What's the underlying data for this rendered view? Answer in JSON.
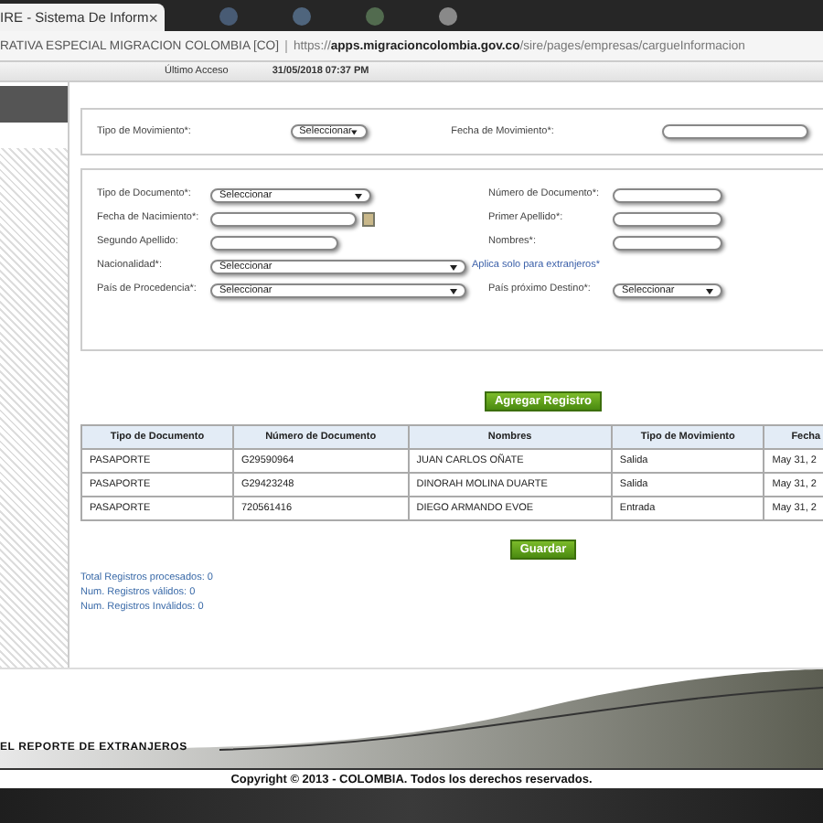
{
  "browser": {
    "tab_title": "IRE - Sistema De Inform",
    "tab_close": "×",
    "site_name": "RATIVA ESPECIAL MIGRACION COLOMBIA [CO]",
    "url_prefix": "https://",
    "url_host": "apps.migracioncolombia.gov.co",
    "url_path": "/sire/pages/empresas/cargueInformacion"
  },
  "header": {
    "last_access_label": "Último Acceso",
    "last_access_value": "31/05/2018 07:37 PM"
  },
  "movement_panel": {
    "fields": [
      {
        "label": "Tipo de Movimiento*:",
        "kind": "select",
        "value": "Seleccionar"
      },
      {
        "label": "Fecha de Movimiento*:",
        "kind": "input"
      }
    ]
  },
  "document_form": {
    "fields": [
      {
        "label": "Tipo de Documento*:",
        "kind": "select",
        "value": "Seleccionar"
      },
      {
        "label": "Número de Documento*:",
        "kind": "input"
      },
      {
        "label": "Fecha de Nacimiento*:",
        "kind": "date"
      },
      {
        "label": "Primer Apellido*:",
        "kind": "input"
      },
      {
        "label": "Segundo Apellido:",
        "kind": "input"
      },
      {
        "label": "Nombres*:",
        "kind": "input"
      },
      {
        "label": "Nacionalidad*:",
        "kind": "select",
        "value": "Seleccionar",
        "note": "Aplica solo para extranjeros*"
      },
      {
        "label": "País de Procedencia*:",
        "kind": "select",
        "value": "Seleccionar"
      },
      {
        "label": "País próximo Destino*:",
        "kind": "select",
        "value": "Seleccionar"
      }
    ]
  },
  "add_button": "Agregar Registro",
  "table": {
    "columns": [
      "Tipo de Documento",
      "Número de Documento",
      "Nombres",
      "Tipo de Movimiento",
      "Fecha"
    ],
    "rows": [
      [
        "PASAPORTE",
        "G29590964",
        "JUAN CARLOS OÑATE",
        "Salida",
        "May 31, 2"
      ],
      [
        "PASAPORTE",
        "G29423248",
        "DINORAH MOLINA DUARTE",
        "Salida",
        "May 31, 2"
      ],
      [
        "PASAPORTE",
        "720561416",
        "DIEGO ARMANDO EVOE",
        "Entrada",
        "May 31, 2"
      ]
    ]
  },
  "save_button": "Guardar",
  "stats": [
    "Total Registros procesados: 0",
    "Num. Registros válidos: 0",
    "Num. Registros Inválidos: 0"
  ],
  "footer": {
    "title": "EL REPORTE DE EXTRANJEROS",
    "copyright": "Copyright © 2013 - COLOMBIA. Todos los derechos reservados."
  }
}
